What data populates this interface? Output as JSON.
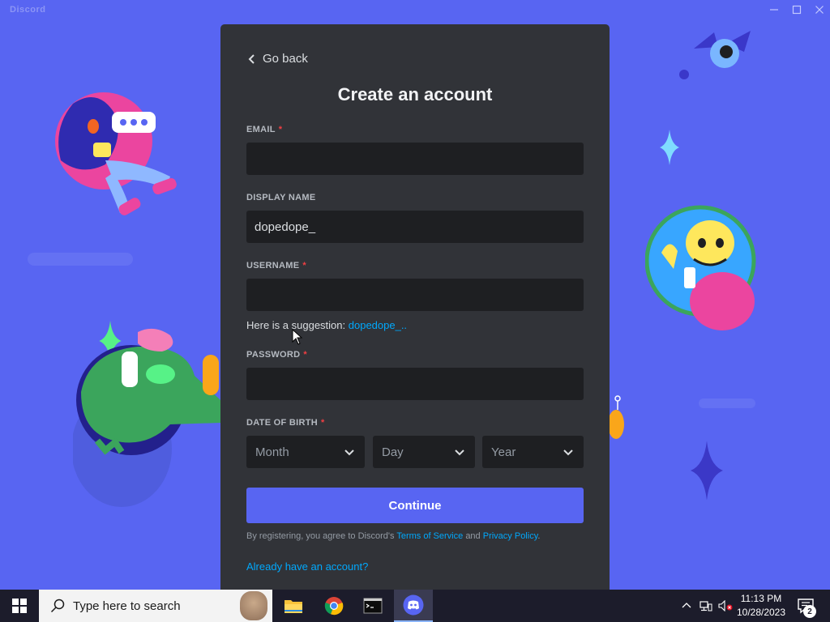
{
  "window": {
    "title": "Discord"
  },
  "form": {
    "back_label": "Go back",
    "title": "Create an account",
    "email": {
      "label": "EMAIL",
      "required": "*",
      "value": ""
    },
    "display_name": {
      "label": "DISPLAY NAME",
      "value": "dopedope_"
    },
    "username": {
      "label": "USERNAME",
      "required": "*",
      "value": ""
    },
    "suggestion": {
      "prefix": "Here is a suggestion:",
      "value": "dopedope_.."
    },
    "password": {
      "label": "PASSWORD",
      "required": "*",
      "value": ""
    },
    "dob": {
      "label": "DATE OF BIRTH",
      "required": "*",
      "month": "Month",
      "day": "Day",
      "year": "Year"
    },
    "continue_label": "Continue",
    "legal": {
      "prefix": "By registering, you agree to Discord's",
      "tos": "Terms of Service",
      "and": "and",
      "privacy": "Privacy Policy",
      "suffix": "."
    },
    "login_link": "Already have an account?"
  },
  "taskbar": {
    "search_placeholder": "Type here to search",
    "time": "11:13 PM",
    "date": "10/28/2023",
    "notification_count": "2"
  },
  "colors": {
    "background": "#5865f2",
    "modal": "#313338",
    "input": "#1e1f22",
    "accent": "#5865f2",
    "link": "#00a8fc",
    "required": "#f23f43"
  }
}
